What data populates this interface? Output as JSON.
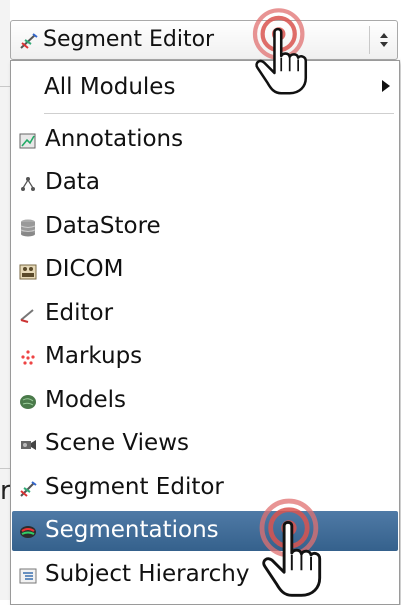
{
  "combo": {
    "selected_label": "Segment Editor",
    "icon": "segment-editor-icon"
  },
  "menu": {
    "all_modules_label": "All Modules",
    "items": [
      {
        "label": "Annotations",
        "icon": "annotations-icon"
      },
      {
        "label": "Data",
        "icon": "data-tree-icon"
      },
      {
        "label": "DataStore",
        "icon": "datastore-icon"
      },
      {
        "label": "DICOM",
        "icon": "dicom-icon"
      },
      {
        "label": "Editor",
        "icon": "editor-pen-icon"
      },
      {
        "label": "Markups",
        "icon": "markups-icon"
      },
      {
        "label": "Models",
        "icon": "models-icon"
      },
      {
        "label": "Scene Views",
        "icon": "scene-views-icon"
      },
      {
        "label": "Segment Editor",
        "icon": "segment-editor-icon"
      },
      {
        "label": "Segmentations",
        "icon": "segmentations-icon",
        "selected": true
      },
      {
        "label": "Subject Hierarchy",
        "icon": "subject-hierarchy-icon"
      }
    ]
  },
  "background": {
    "fragment_text": "r"
  },
  "colors": {
    "selection": "#3d6894",
    "click_ring": "#d9534f"
  }
}
